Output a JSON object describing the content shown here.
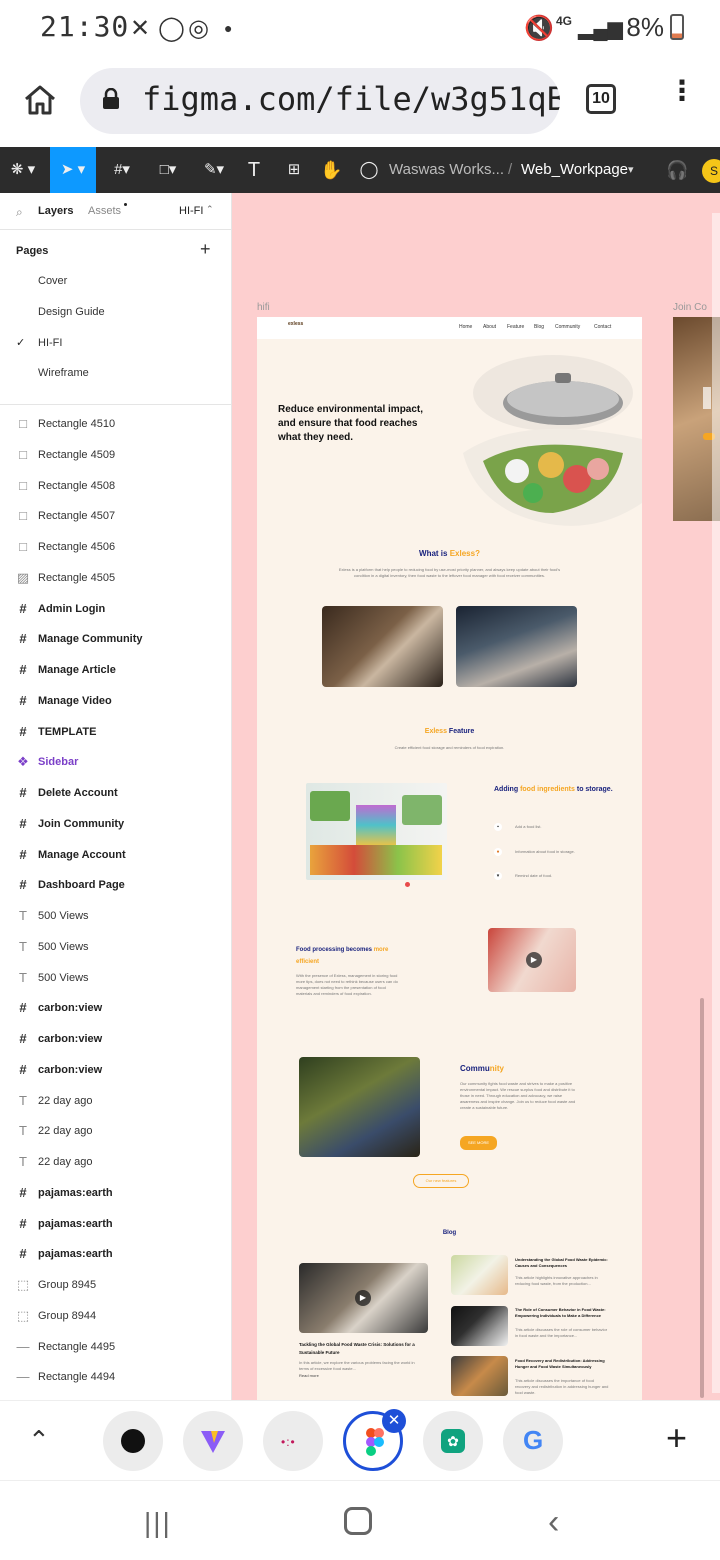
{
  "status_bar": {
    "time": "21:30",
    "network": "4G",
    "battery": "8%"
  },
  "browser": {
    "url": "figma.com/file/w3g51qB",
    "tab_count": "10"
  },
  "figma_toolbar": {
    "workspace": "Waswas Works...",
    "separator": "/",
    "file_name": "Web_Workpage",
    "avatar_initial": "S"
  },
  "panel": {
    "tab_layers": "Layers",
    "tab_assets": "Assets",
    "page_select": "HI-FI",
    "pages_header": "Pages",
    "pages": [
      "Cover",
      "Design Guide",
      "HI-FI",
      "Wireframe"
    ],
    "layers": [
      {
        "name": "Rectangle 4510",
        "kind": "rect"
      },
      {
        "name": "Rectangle 4509",
        "kind": "rect"
      },
      {
        "name": "Rectangle 4508",
        "kind": "rect"
      },
      {
        "name": "Rectangle 4507",
        "kind": "rect"
      },
      {
        "name": "Rectangle 4506",
        "kind": "rect"
      },
      {
        "name": "Rectangle 4505",
        "kind": "image"
      },
      {
        "name": "Admin Login",
        "kind": "frame"
      },
      {
        "name": "Manage Community",
        "kind": "frame"
      },
      {
        "name": "Manage Article",
        "kind": "frame"
      },
      {
        "name": "Manage Video",
        "kind": "frame"
      },
      {
        "name": "TEMPLATE",
        "kind": "frame"
      },
      {
        "name": "Sidebar",
        "kind": "component"
      },
      {
        "name": "Delete Account",
        "kind": "frame"
      },
      {
        "name": "Join Community",
        "kind": "frame"
      },
      {
        "name": "Manage Account",
        "kind": "frame"
      },
      {
        "name": "Dashboard Page",
        "kind": "frame"
      },
      {
        "name": "500 Views",
        "kind": "text"
      },
      {
        "name": "500 Views",
        "kind": "text"
      },
      {
        "name": "500 Views",
        "kind": "text"
      },
      {
        "name": "carbon:view",
        "kind": "frame"
      },
      {
        "name": "carbon:view",
        "kind": "frame"
      },
      {
        "name": "carbon:view",
        "kind": "frame"
      },
      {
        "name": "22 day ago",
        "kind": "text"
      },
      {
        "name": "22 day ago",
        "kind": "text"
      },
      {
        "name": "22 day ago",
        "kind": "text"
      },
      {
        "name": "pajamas:earth",
        "kind": "frame"
      },
      {
        "name": "pajamas:earth",
        "kind": "frame"
      },
      {
        "name": "pajamas:earth",
        "kind": "frame"
      },
      {
        "name": "Group 8945",
        "kind": "group"
      },
      {
        "name": "Group 8944",
        "kind": "group"
      },
      {
        "name": "Rectangle 4495",
        "kind": "line"
      },
      {
        "name": "Rectangle 4494",
        "kind": "line"
      }
    ]
  },
  "canvas": {
    "frame_label": "hifi",
    "next_frame_label": "Join Co",
    "site": {
      "logo": "exless",
      "nav": [
        "Home",
        "About",
        "Feature",
        "Blog",
        "Community",
        "Contact"
      ],
      "hero_title": "Reduce environmental impact, and ensure that food reaches what they need.",
      "what_is_prefix": "What is",
      "what_is_brand": "Exless?",
      "what_is_body": "Exless is a platform that help people to reducing food by use-most priority planner, and always keep update about their food's condition in a digital inventory, then food waste to the leftover food manager with food receiver communities.",
      "feature_brand": "Exless",
      "feature_title": "Feature",
      "feature_sub": "Create efficient food storage and reminders of food expiration.",
      "adding_pre": "Adding",
      "adding_hl": "food ingredients",
      "adding_post": "to storage.",
      "feature_items": [
        "Add a food list.",
        "Information about food in storage.",
        "Remind date of food."
      ],
      "processing_title": "Food processing becomes",
      "processing_hl": "more efficient",
      "processing_body": "With the presence of Exless, management in storing food more tips, does not need to rethink because users can do management starting from the presentation of food materials and reminders of food expiration.",
      "community_title_a": "Commu",
      "community_title_b": "nity",
      "community_body": "Our community fights food waste and strives to make a positive environmental impact. We rescue surplus food and distribute it to those in need. Through education and advocacy, we raise awareness and inspire change. Join us to reduce food waste and create a sustainable future.",
      "see_more": "SEE MORE",
      "our_features": "Our new features",
      "blog_title": "Blog",
      "blog_main_title": "Tackling the Global Food Waste Crisis: Solutions for a Sustainable Future",
      "blog_main_body": "In this article, we explore the various problems facing the world in terms of excessive food waste...",
      "blog_main_more": "Read more",
      "blog_items": [
        {
          "title": "Understanding the Global Food Waste Epidemic: Causes and Consequences",
          "body": "This article highlights innovative approaches in reducing food waste, from the production..."
        },
        {
          "title": "The Role of Consumer Behavior in Food Waste: Empowering Individuals to Make a Difference",
          "body": "This article discusses the role of consumer behavior in food waste and the importance..."
        },
        {
          "title": "Food Recovery and Redistribution: Addressing Hunger and Food Waste Simultaneously",
          "body": "This article discusses the importance of food recovery and redistribution in addressing hunger and food waste."
        }
      ]
    }
  },
  "dock": {
    "icons": [
      "github-app",
      "vite-app",
      "dots-app",
      "figma-app",
      "chatgpt-app",
      "google-app"
    ]
  }
}
